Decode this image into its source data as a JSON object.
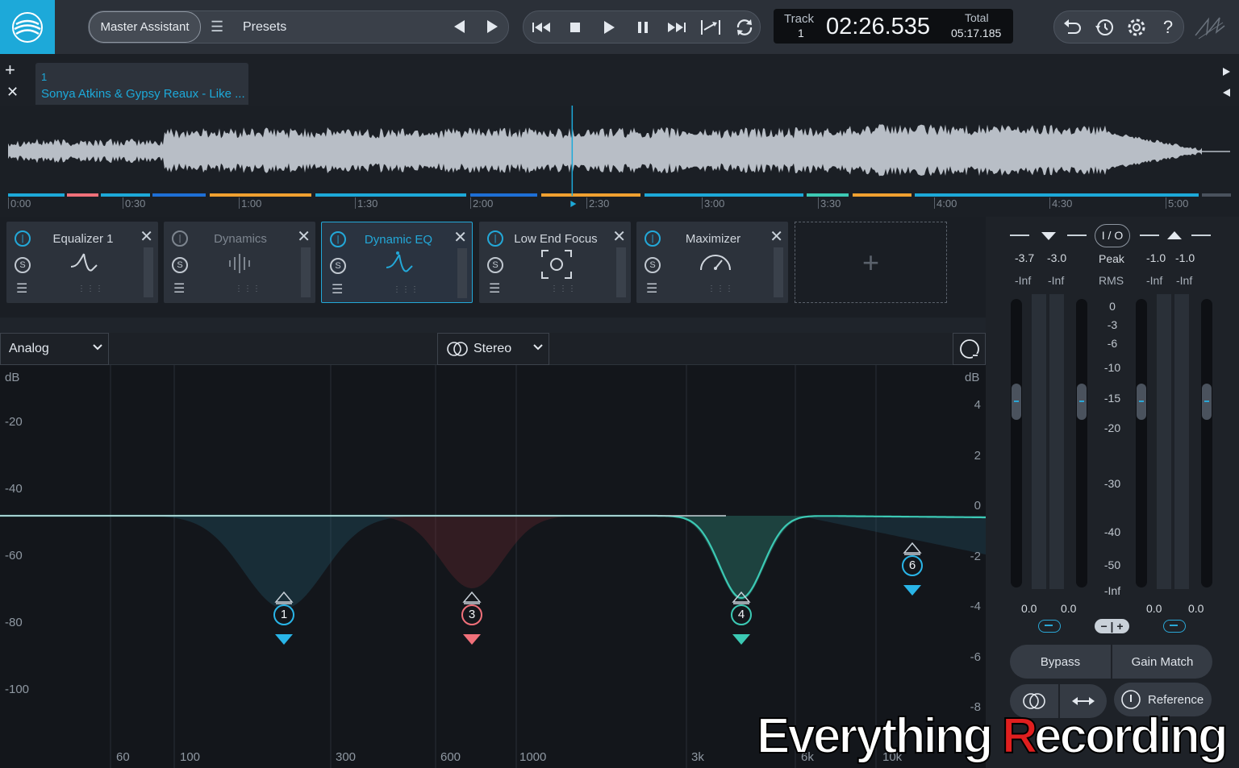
{
  "header": {
    "master_assistant": "Master Assistant",
    "presets": "Presets",
    "track_label": "Track",
    "track_number": "1",
    "current_time": "02:26.535",
    "total_label": "Total",
    "total_time": "05:17.185"
  },
  "tabs": {
    "track_index": "1",
    "track_name": "Sonya Atkins & Gypsy Reaux - Like ..."
  },
  "timeline": {
    "ticks": [
      "0:00",
      "0:30",
      "1:00",
      "1:30",
      "2:00",
      "2:30",
      "3:00",
      "3:30",
      "4:00",
      "4:30",
      "5:00"
    ],
    "playhead_fraction": 0.461
  },
  "modules": [
    {
      "name": "Equalizer 1",
      "active": true
    },
    {
      "name": "Dynamics",
      "active": false
    },
    {
      "name": "Dynamic EQ",
      "active": true,
      "selected": true
    },
    {
      "name": "Low End Focus",
      "active": true
    },
    {
      "name": "Maximizer",
      "active": true
    }
  ],
  "eq": {
    "mode": "Analog",
    "channel": "Stereo",
    "db_label_left": "dB",
    "db_label_right": "dB",
    "left_scale": [
      "-20",
      "-40",
      "-60",
      "-80",
      "-100"
    ],
    "right_scale": [
      "4",
      "2",
      "0",
      "-2",
      "-4",
      "-6",
      "-8"
    ],
    "freq_labels": [
      "60",
      "100",
      "300",
      "600",
      "1000",
      "3k",
      "6k",
      "10k"
    ],
    "nodes": [
      {
        "label": "1",
        "color": "#29b5e8"
      },
      {
        "label": "3",
        "color": "#f0707a"
      },
      {
        "label": "4",
        "color": "#3cc9b4"
      },
      {
        "label": "6",
        "color": "#29b5e8"
      }
    ]
  },
  "meters": {
    "in_peak": [
      "-3.7",
      "-3.0"
    ],
    "out_peak": [
      "-1.0",
      "-1.0"
    ],
    "in_rms": [
      "-Inf",
      "-Inf"
    ],
    "out_rms": [
      "-Inf",
      "-Inf"
    ],
    "io_label": "I / O",
    "peak_label": "Peak",
    "rms_label": "RMS",
    "scale": [
      "0",
      "-3",
      "-6",
      "-10",
      "-15",
      "-20",
      "-30",
      "-40",
      "-50",
      "-Inf"
    ],
    "in_gain": [
      "0.0",
      "0.0"
    ],
    "out_gain": [
      "0.0",
      "0.0"
    ],
    "bypass": "Bypass",
    "gain_match": "Gain Match",
    "reference": "Reference"
  },
  "watermark": "Everything Recording",
  "colors": {
    "accent": "#1da9d9",
    "eq_curve": "#3cc9b4",
    "node_red": "#f0707a"
  }
}
